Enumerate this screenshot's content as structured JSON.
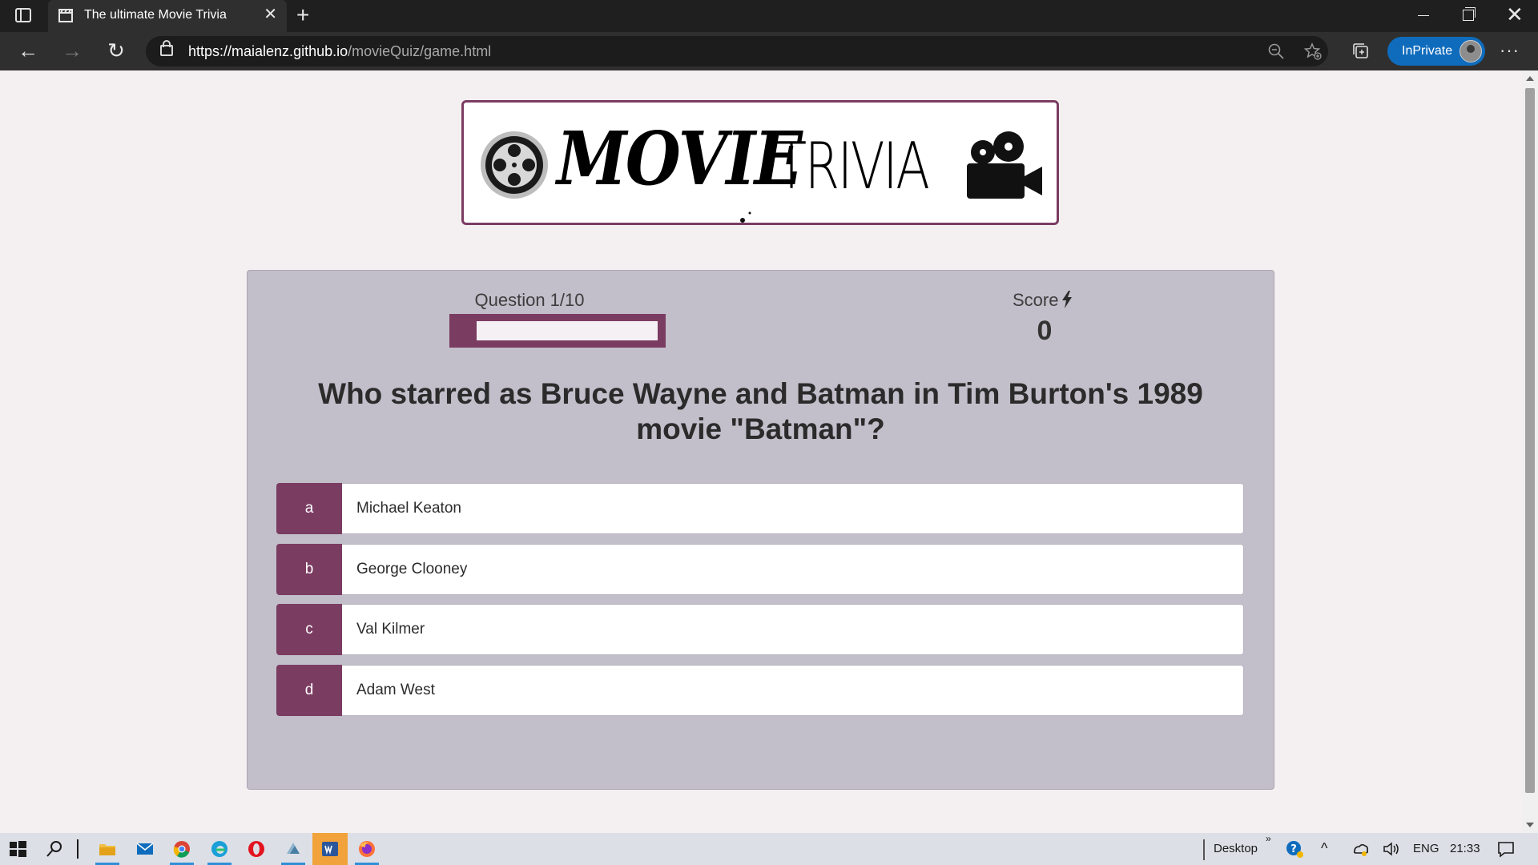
{
  "browser": {
    "tab_title": "The ultimate Movie Trivia",
    "url_host": "https://maialenz.github.io",
    "url_path": "/movieQuiz/game.html",
    "inprivate_label": "InPrivate"
  },
  "logo": {
    "movie_text": "MOVIE",
    "trivia_text": "TRIVIA"
  },
  "game": {
    "question_counter": "Question 1/10",
    "progress_fraction": 0.1,
    "score_label": "Score",
    "score_value": "0",
    "question_text": "Who starred as Bruce Wayne and Batman in Tim Burton's 1989 movie \"Batman\"?",
    "options": [
      {
        "letter": "a",
        "text": "Michael Keaton"
      },
      {
        "letter": "b",
        "text": "George Clooney"
      },
      {
        "letter": "c",
        "text": "Val Kilmer"
      },
      {
        "letter": "d",
        "text": "Adam West"
      }
    ]
  },
  "colors": {
    "accent": "#7b3c62",
    "panel": "#c2bfca",
    "page_bg": "#f4f0f1"
  },
  "taskbar": {
    "desktop_label": "Desktop",
    "language": "ENG",
    "time": "21:33"
  }
}
